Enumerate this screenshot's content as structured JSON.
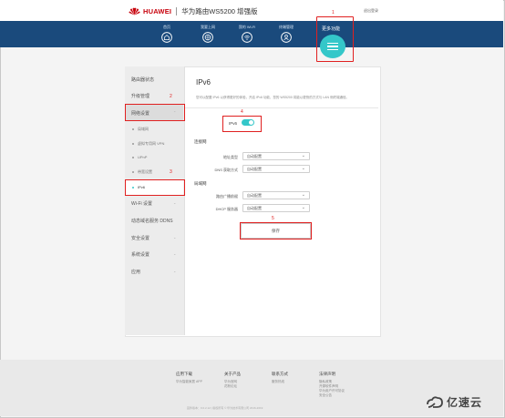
{
  "header": {
    "brand": "HUAWEI",
    "model": "华为路由WS5200 增强版",
    "language": "退出登录",
    "brand_color": "#c7000b",
    "nav_color": "#1a4a7c"
  },
  "nav": {
    "items": [
      {
        "label": "首页",
        "icon": "home-icon"
      },
      {
        "label": "我要上网",
        "icon": "globe-icon"
      },
      {
        "label": "我的 Wi-Fi",
        "icon": "wifi-icon"
      },
      {
        "label": "终端管理",
        "icon": "user-icon"
      }
    ],
    "more_label": "更多功能",
    "more_icon": "menu-icon",
    "accent_color": "#34c7c9"
  },
  "annotations": [
    "1",
    "2",
    "3",
    "4",
    "5"
  ],
  "sidebar": {
    "items": [
      {
        "label": "路由器状态"
      },
      {
        "label": "升级管理"
      },
      {
        "label": "网络设置"
      },
      {
        "label": "Wi-Fi 设置"
      },
      {
        "label": "动态域名服务 DDNS"
      },
      {
        "label": "安全设置"
      },
      {
        "label": "系统设置"
      },
      {
        "label": "应用"
      }
    ],
    "subitems": [
      {
        "label": "局域网"
      },
      {
        "label": "虚拟专用网 VPN"
      },
      {
        "label": "UPnP"
      },
      {
        "label": "带宽设置"
      },
      {
        "label": "IPv6"
      }
    ]
  },
  "main": {
    "title": "IPv6",
    "description": "您可以配置 IPv6 以获得更好的体验，开启 IPv6 功能，您的 WS5200 将能以更快的方式与 LAN 侧终端通信。",
    "toggle_label": "IPv6",
    "toggle_on": true,
    "wan_section": "连接网",
    "lan_section": "局域网",
    "fields": [
      {
        "label": "地址类型",
        "value": "自动配置"
      },
      {
        "label": "DNS 获取方式",
        "value": "自动配置"
      },
      {
        "label": "路由广播前缀",
        "value": "自动配置"
      },
      {
        "label": "DHCP 服务器",
        "value": "自动配置"
      }
    ],
    "save_label": "保存"
  },
  "footer": {
    "columns": [
      {
        "title": "应用下载",
        "links": [
          "华为智能家居 APP"
        ]
      },
      {
        "title": "关于产品",
        "links": [
          "华为官网",
          "花粉论坛"
        ]
      },
      {
        "title": "联系方式",
        "links": [
          "服务热线"
        ]
      },
      {
        "title": "法律声明",
        "links": [
          "隐私政策",
          "开源软件声明",
          "华为用户许可协议",
          "安全公告"
        ]
      }
    ],
    "copyright": "固件版本：9.0.2.12 | 版权所有 © 华为技术有限公司 2016-2019"
  },
  "watermark": {
    "text": "亿速云"
  }
}
